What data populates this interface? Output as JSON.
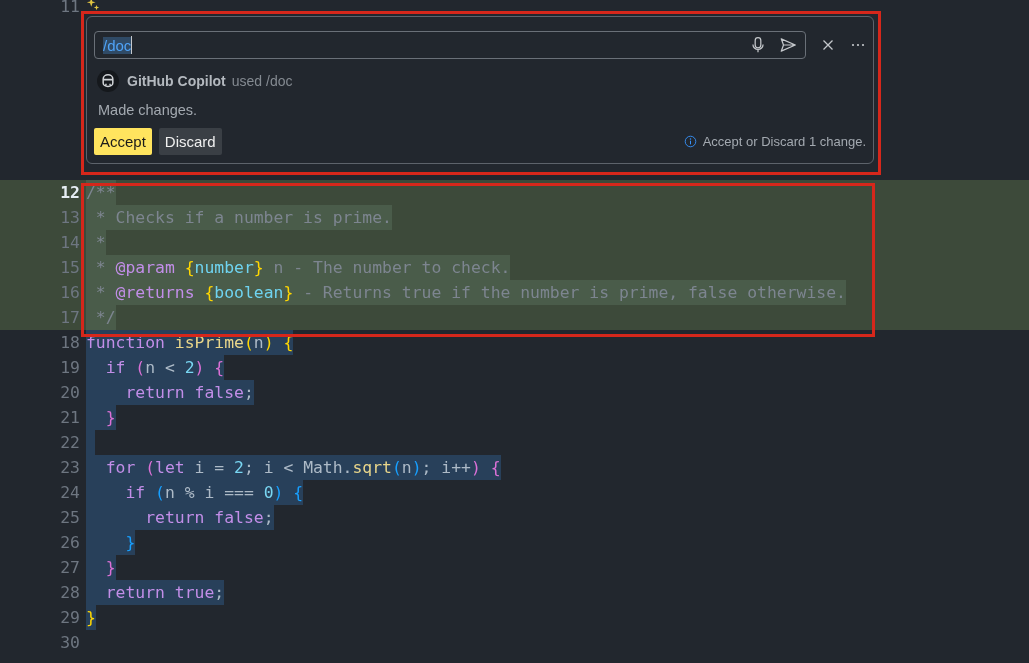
{
  "editor": {
    "lines": [
      {
        "kind": "hint",
        "number": "11",
        "current": false,
        "added": false,
        "selected": false,
        "annotated": false
      },
      {
        "kind": "code",
        "number": "12",
        "current": true,
        "added": true,
        "selected": true,
        "annotated": true,
        "tokens": [
          {
            "kind": "comment",
            "text": "/**"
          }
        ]
      },
      {
        "kind": "code",
        "number": "13",
        "current": false,
        "added": true,
        "selected": true,
        "annotated": true,
        "tokens": [
          {
            "kind": "comment",
            "text": " * Checks if a number is prime."
          }
        ]
      },
      {
        "kind": "code",
        "number": "14",
        "current": false,
        "added": true,
        "selected": true,
        "annotated": true,
        "tokens": [
          {
            "kind": "comment",
            "text": " *"
          }
        ]
      },
      {
        "kind": "code",
        "number": "15",
        "current": false,
        "added": true,
        "selected": true,
        "annotated": true,
        "tokens": [
          {
            "kind": "comment",
            "text": " * "
          },
          {
            "kind": "tag",
            "text": "@param"
          },
          {
            "kind": "bracket1",
            "text": " {"
          },
          {
            "kind": "type",
            "text": "number"
          },
          {
            "kind": "bracket1",
            "text": "}"
          },
          {
            "kind": "comment",
            "text": " n - The number to check."
          }
        ]
      },
      {
        "kind": "code",
        "number": "16",
        "current": false,
        "added": true,
        "selected": true,
        "annotated": true,
        "tokens": [
          {
            "kind": "comment",
            "text": " * "
          },
          {
            "kind": "tag",
            "text": "@returns"
          },
          {
            "kind": "bracket1",
            "text": " {"
          },
          {
            "kind": "type",
            "text": "boolean"
          },
          {
            "kind": "bracket1",
            "text": "}"
          },
          {
            "kind": "comment",
            "text": " - Returns true if the number is prime, false otherwise."
          }
        ]
      },
      {
        "kind": "code",
        "number": "17",
        "current": false,
        "added": true,
        "selected": true,
        "annotated": true,
        "tokens": [
          {
            "kind": "comment",
            "text": " */"
          }
        ]
      },
      {
        "kind": "code",
        "number": "18",
        "current": false,
        "added": false,
        "selected": true,
        "annotated": false,
        "tokens": [
          {
            "kind": "keyword",
            "text": "function"
          },
          {
            "kind": "function",
            "text": " isPrime"
          },
          {
            "kind": "bracket1",
            "text": "("
          },
          {
            "kind": "plain",
            "text": "n"
          },
          {
            "kind": "bracket1",
            "text": ")"
          },
          {
            "kind": "bracket1",
            "text": " {"
          }
        ]
      },
      {
        "kind": "code",
        "number": "19",
        "current": false,
        "added": false,
        "selected": true,
        "annotated": false,
        "tokens": [
          {
            "kind": "keyword",
            "text": "  if"
          },
          {
            "kind": "bracket2",
            "text": " ("
          },
          {
            "kind": "plain",
            "text": "n < "
          },
          {
            "kind": "number",
            "text": "2"
          },
          {
            "kind": "bracket2",
            "text": ")"
          },
          {
            "kind": "bracket2",
            "text": " {"
          }
        ]
      },
      {
        "kind": "code",
        "number": "20",
        "current": false,
        "added": false,
        "selected": true,
        "annotated": false,
        "tokens": [
          {
            "kind": "keyword",
            "text": "    return false"
          },
          {
            "kind": "plain",
            "text": ";"
          }
        ]
      },
      {
        "kind": "code",
        "number": "21",
        "current": false,
        "added": false,
        "selected": true,
        "annotated": false,
        "tokens": [
          {
            "kind": "bracket2",
            "text": "  }"
          }
        ]
      },
      {
        "kind": "code",
        "number": "22",
        "current": false,
        "added": false,
        "selected": true,
        "annotated": false
      },
      {
        "kind": "code",
        "number": "23",
        "current": false,
        "added": false,
        "selected": true,
        "annotated": false,
        "tokens": [
          {
            "kind": "keyword",
            "text": "  for"
          },
          {
            "kind": "bracket2",
            "text": " ("
          },
          {
            "kind": "keyword",
            "text": "let"
          },
          {
            "kind": "plain",
            "text": " i = "
          },
          {
            "kind": "number",
            "text": "2"
          },
          {
            "kind": "plain",
            "text": "; i < Math."
          },
          {
            "kind": "function",
            "text": "sqrt"
          },
          {
            "kind": "bracket3",
            "text": "("
          },
          {
            "kind": "plain",
            "text": "n"
          },
          {
            "kind": "bracket3",
            "text": ")"
          },
          {
            "kind": "plain",
            "text": "; i++"
          },
          {
            "kind": "bracket2",
            "text": ")"
          },
          {
            "kind": "bracket2",
            "text": " {"
          }
        ]
      },
      {
        "kind": "code",
        "number": "24",
        "current": false,
        "added": false,
        "selected": true,
        "annotated": false,
        "tokens": [
          {
            "kind": "keyword",
            "text": "    if"
          },
          {
            "kind": "bracket3",
            "text": " ("
          },
          {
            "kind": "plain",
            "text": "n % i === "
          },
          {
            "kind": "number",
            "text": "0"
          },
          {
            "kind": "bracket3",
            "text": ")"
          },
          {
            "kind": "bracket3",
            "text": " {"
          }
        ]
      },
      {
        "kind": "code",
        "number": "25",
        "current": false,
        "added": false,
        "selected": true,
        "annotated": false,
        "tokens": [
          {
            "kind": "keyword",
            "text": "      return false"
          },
          {
            "kind": "plain",
            "text": ";"
          }
        ]
      },
      {
        "kind": "code",
        "number": "26",
        "current": false,
        "added": false,
        "selected": true,
        "annotated": false,
        "tokens": [
          {
            "kind": "bracket3",
            "text": "    }"
          }
        ]
      },
      {
        "kind": "code",
        "number": "27",
        "current": false,
        "added": false,
        "selected": true,
        "annotated": false,
        "tokens": [
          {
            "kind": "bracket2",
            "text": "  }"
          }
        ]
      },
      {
        "kind": "code",
        "number": "28",
        "current": false,
        "added": false,
        "selected": true,
        "annotated": false,
        "tokens": [
          {
            "kind": "keyword",
            "text": "  return true"
          },
          {
            "kind": "plain",
            "text": ";"
          }
        ]
      },
      {
        "kind": "code",
        "number": "29",
        "current": false,
        "added": false,
        "selected": true,
        "annotated": false,
        "tokens": [
          {
            "kind": "bracket1",
            "text": "}"
          }
        ]
      },
      {
        "kind": "code",
        "number": "30",
        "current": false,
        "added": false,
        "selected": false,
        "annotated": false
      }
    ]
  },
  "inline_chat": {
    "annotated": true,
    "input": {
      "value": "/doc"
    },
    "agent": {
      "name": "GitHub Copilot",
      "action": "used /doc"
    },
    "message": "Made changes.",
    "buttons": [
      {
        "label": "Accept",
        "kind": "primary"
      },
      {
        "label": "Discard",
        "kind": "secondary"
      }
    ],
    "hint": "Accept or Discard 1 change."
  }
}
